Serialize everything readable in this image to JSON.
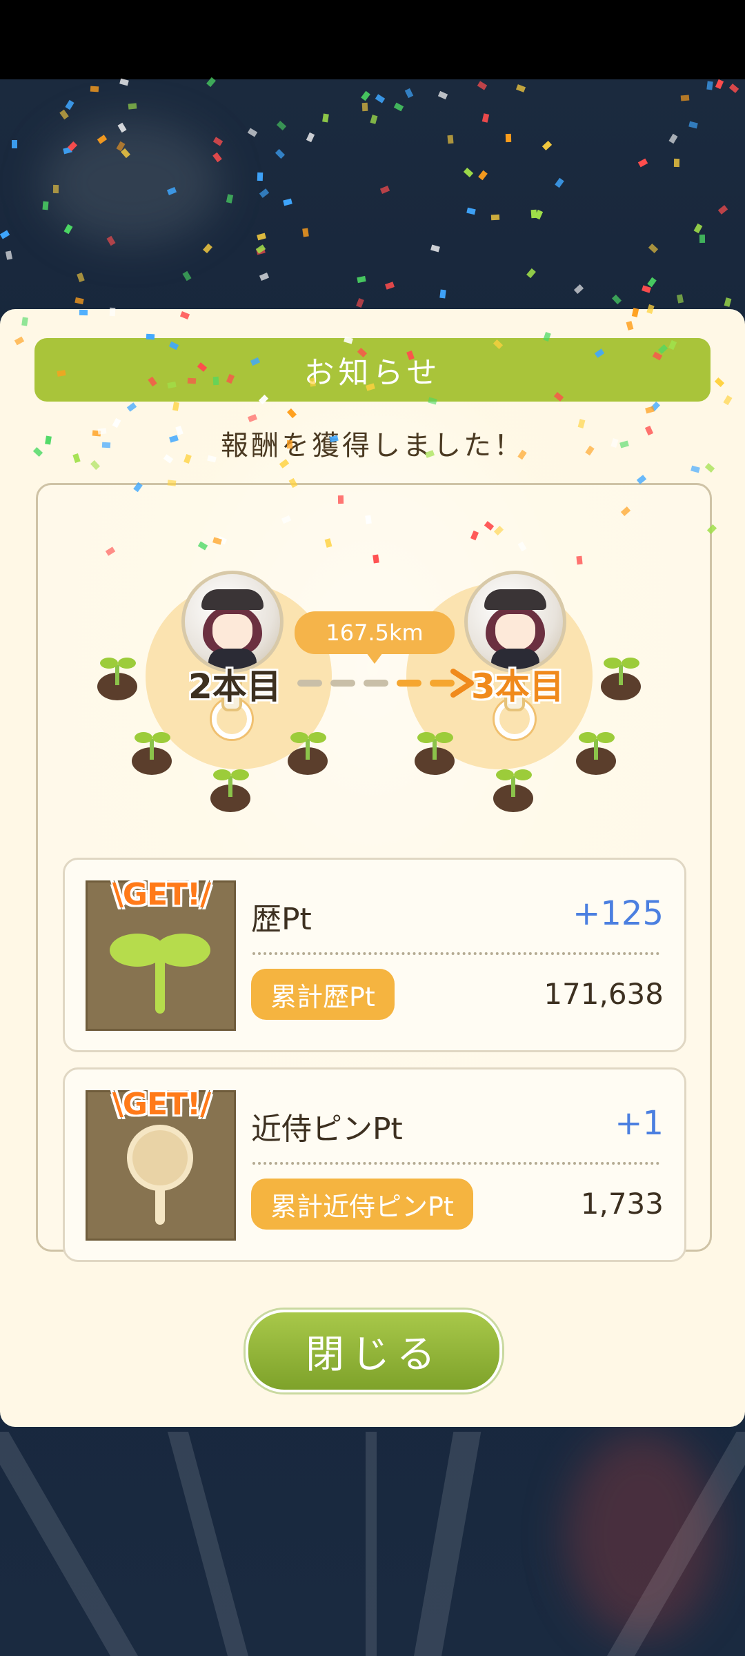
{
  "dialog": {
    "header_title": "お知らせ",
    "subtitle": "報酬を獲得しました！",
    "scene": {
      "from_label": "2本目",
      "to_label": "3本目",
      "distance": "167.5km"
    },
    "rewards": [
      {
        "get_label": "\\GET!/",
        "name": "歴Pt",
        "gain": "+125",
        "total_label": "累計歴Pt",
        "total_value": "171,638",
        "icon": "sprout-icon"
      },
      {
        "get_label": "\\GET!/",
        "name": "近侍ピンPt",
        "gain": "+1",
        "total_label": "累計近侍ピンPt",
        "total_value": "1,733",
        "icon": "pin-icon"
      }
    ],
    "close_label": "閉じる"
  },
  "colors": {
    "accent_green": "#a9c43a",
    "accent_orange": "#f5b44a",
    "gain_blue": "#4b7fe0",
    "to_label_orange": "#f08a1c"
  }
}
